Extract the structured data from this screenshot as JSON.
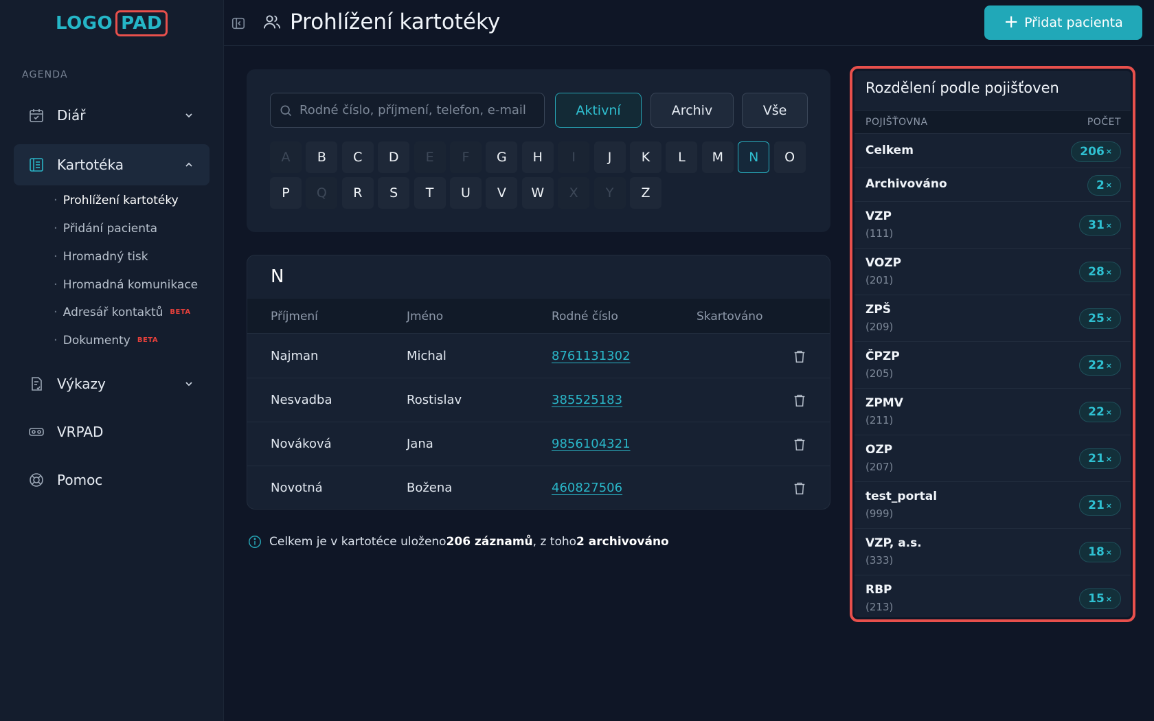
{
  "logo": {
    "part_a": "LOGO",
    "part_b": "PAD"
  },
  "header": {
    "title": "Prohlížení kartotéky",
    "add_button": "Přidat pacienta"
  },
  "sidebar": {
    "section_label": "AGENDA",
    "items": [
      {
        "label": "Diář",
        "icon": "calendar-icon"
      },
      {
        "label": "Kartotéka",
        "icon": "records-icon"
      },
      {
        "label": "Výkazy",
        "icon": "report-icon"
      },
      {
        "label": "VRPAD",
        "icon": "vr-headset-icon"
      },
      {
        "label": "Pomoc",
        "icon": "lifebuoy-icon"
      }
    ],
    "sub_items": [
      {
        "label": "Prohlížení kartotéky"
      },
      {
        "label": "Přidání pacienta"
      },
      {
        "label": "Hromadný tisk"
      },
      {
        "label": "Hromadná komunikace"
      },
      {
        "label": "Adresář kontaktů",
        "badge": "BETA"
      },
      {
        "label": "Dokumenty",
        "badge": "BETA"
      }
    ]
  },
  "filter": {
    "search_placeholder": "Rodné číslo, příjmení, telefon, e-mail",
    "buttons": [
      "Aktivní",
      "Archiv",
      "Vše"
    ],
    "active_button": "Aktivní",
    "letters": [
      "A",
      "B",
      "C",
      "D",
      "E",
      "F",
      "G",
      "H",
      "I",
      "J",
      "K",
      "L",
      "M",
      "N",
      "O",
      "P",
      "Q",
      "R",
      "S",
      "T",
      "U",
      "V",
      "W",
      "X",
      "Y",
      "Z"
    ],
    "disabled_letters": [
      "A",
      "E",
      "F",
      "I",
      "Q",
      "X",
      "Y"
    ],
    "selected_letter": "N"
  },
  "table": {
    "group_letter": "N",
    "columns": [
      "Příjmení",
      "Jméno",
      "Rodné číslo",
      "Skartováno"
    ],
    "rows": [
      {
        "surname": "Najman",
        "name": "Michal",
        "rc": "8761131302"
      },
      {
        "surname": "Nesvadba",
        "name": "Rostislav",
        "rc": "385525183"
      },
      {
        "surname": "Nováková",
        "name": "Jana",
        "rc": "9856104321"
      },
      {
        "surname": "Novotná",
        "name": "Božena",
        "rc": "460827506"
      }
    ]
  },
  "info": {
    "prefix": "Celkem je v kartotéce uloženo ",
    "count": "206 záznamů",
    "middle": ", z toho ",
    "archived": "2 archivováno"
  },
  "insurance": {
    "title": "Rozdělení podle pojišťoven",
    "col_name": "POJIŠŤOVNA",
    "col_count": "POČET",
    "count_suffix": "×",
    "rows": [
      {
        "name": "Celkem",
        "code": "",
        "count": "206"
      },
      {
        "name": "Archivováno",
        "code": "",
        "count": "2"
      },
      {
        "name": "VZP",
        "code": "(111)",
        "count": "31"
      },
      {
        "name": "VOZP",
        "code": "(201)",
        "count": "28"
      },
      {
        "name": "ZPŠ",
        "code": "(209)",
        "count": "25"
      },
      {
        "name": "ČPZP",
        "code": "(205)",
        "count": "22"
      },
      {
        "name": "ZPMV",
        "code": "(211)",
        "count": "22"
      },
      {
        "name": "OZP",
        "code": "(207)",
        "count": "21"
      },
      {
        "name": "test_portal",
        "code": "(999)",
        "count": "21"
      },
      {
        "name": "VZP, a.s.",
        "code": "(333)",
        "count": "18"
      },
      {
        "name": "RBP",
        "code": "(213)",
        "count": "15"
      }
    ]
  },
  "colors": {
    "accent": "#21a8b8",
    "highlight_border": "#e8504c",
    "background": "#0f1626",
    "beta": "#e5403b"
  }
}
